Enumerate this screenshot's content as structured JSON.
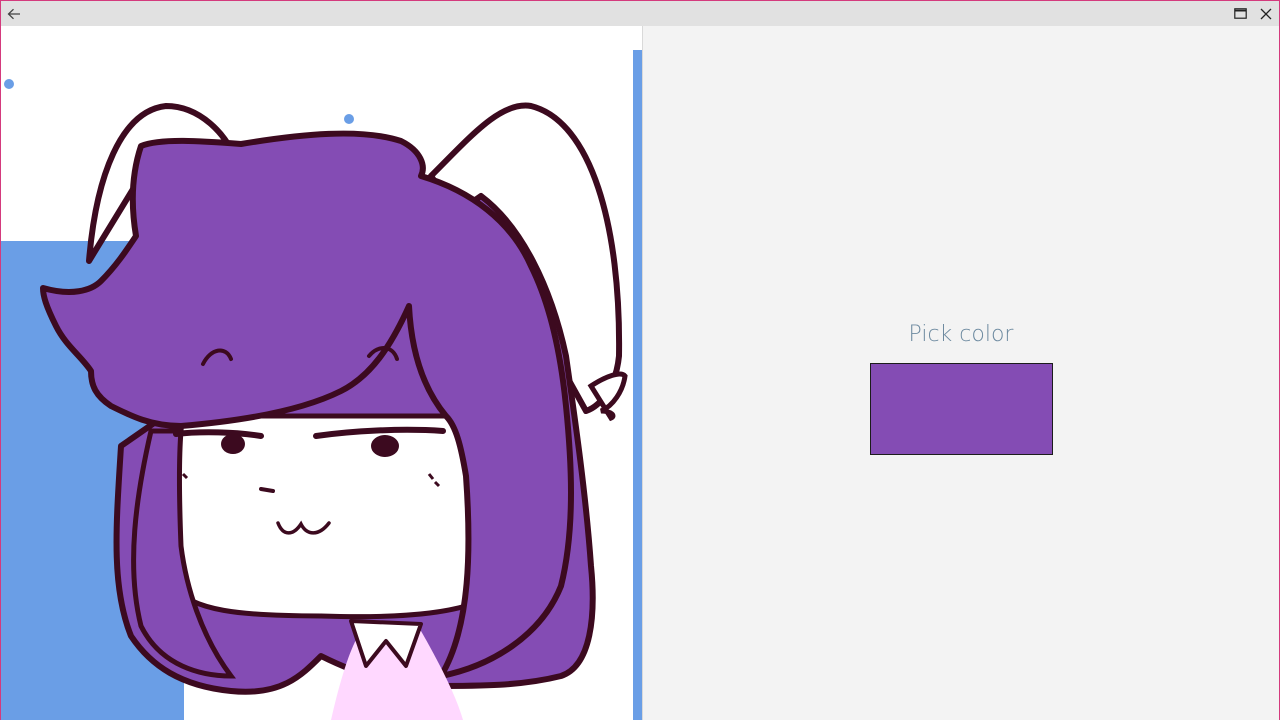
{
  "picker": {
    "label": "Pick color",
    "selected_color": "#844cb4"
  },
  "titlebar": {
    "back_icon": "arrow-left-icon",
    "maximize_icon": "maximize-icon",
    "close_icon": "close-icon"
  },
  "colors": {
    "window_border": "#d43a7d",
    "titlebar_bg": "#e1e1e1",
    "hair_purple": "#844cb4",
    "outline_dark": "#3c0a1f",
    "background_blue": "#6a9ee6",
    "shirt_pink": "#ffd8ff"
  }
}
